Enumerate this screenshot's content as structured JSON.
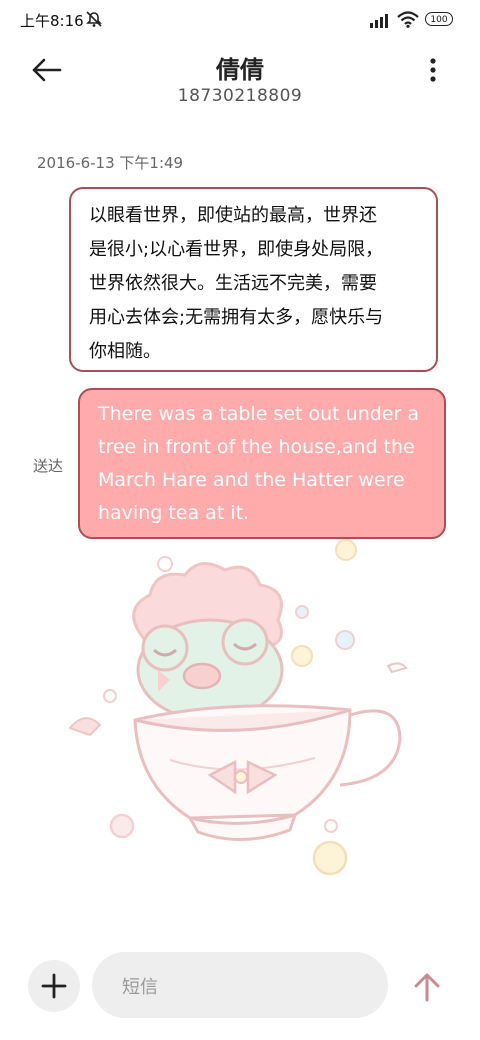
{
  "status_bar": {
    "time": "上午8:16",
    "battery": "100",
    "icons": [
      "mute-icon",
      "signal-icon",
      "wifi-icon",
      "battery-icon"
    ]
  },
  "header": {
    "contact_name": "倩倩",
    "contact_number": "18730218809",
    "icons": [
      "back-arrow-icon",
      "more-vertical-icon"
    ]
  },
  "conversation": {
    "timestamp": "2016-6-13 下午1:49",
    "messages": [
      {
        "direction": "incoming",
        "lines": [
          "以眼看世界，即使站的最高，世界还",
          "是很小;以心看世界，即使身处局限，",
          "世界依然很大。生活远不完美，需要",
          "用心去体会;无需拥有太多，愿快乐与",
          "你相随。"
        ]
      },
      {
        "direction": "outgoing",
        "lines": [
          "There was a table set out under a",
          "tree in front of the house,and the",
          "March Hare and the Hatter were",
          "having tea at it."
        ],
        "status": "送达"
      }
    ]
  },
  "composer": {
    "placeholder": "短信",
    "value": "",
    "icons": [
      "plus-icon",
      "send-arrow-icon"
    ]
  },
  "colors": {
    "bubble_border": "#a94f55",
    "outgoing_bubble_bg": "#ffabab",
    "send_icon": "#c98a90"
  }
}
